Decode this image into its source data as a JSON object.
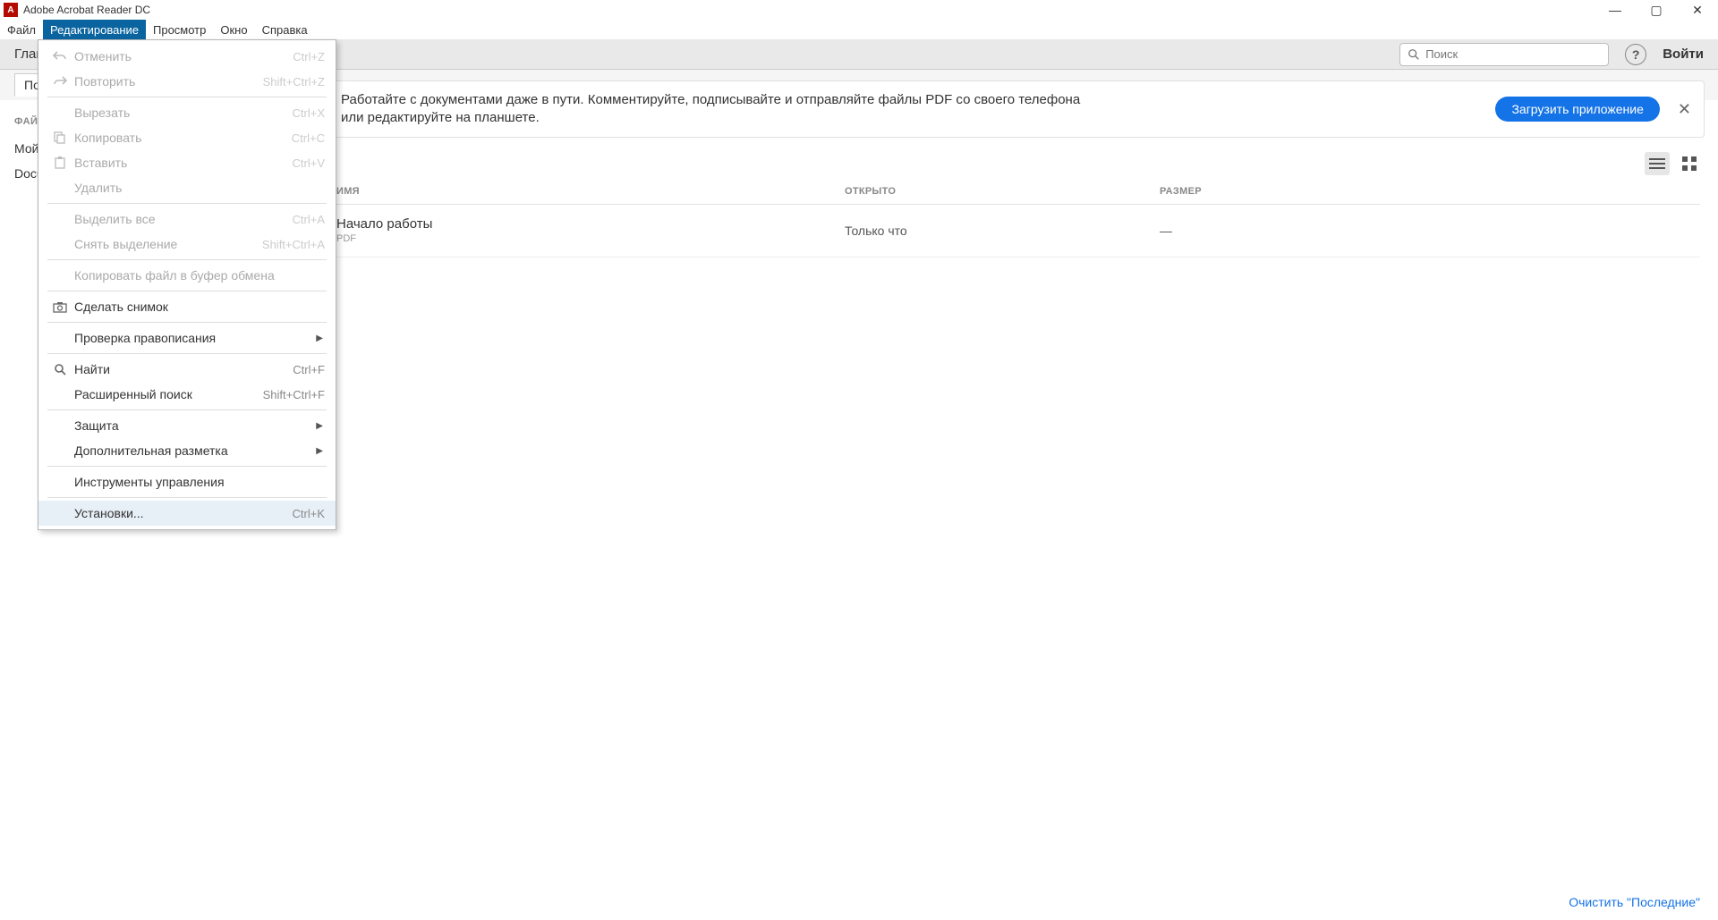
{
  "title": "Adobe Acrobat Reader DC",
  "menubar": [
    "Файл",
    "Редактирование",
    "Просмотр",
    "Окно",
    "Справка"
  ],
  "toolbar": {
    "tab": "Главная",
    "search_placeholder": "Поиск",
    "login": "Войти"
  },
  "secondbar": {
    "item": "Последние"
  },
  "sidebar": {
    "heading": "ФАЙЛЫ",
    "items": [
      "Мой компьютер",
      "Document Cloud"
    ]
  },
  "banner": {
    "line1": "Работайте с документами даже в пути. Комментируйте, подписывайте и отправляйте файлы PDF со своего телефона",
    "line2": "или редактируйте на планшете.",
    "button": "Загрузить приложение"
  },
  "table": {
    "headers": {
      "name": "ИМЯ",
      "opened": "ОТКРЫТО",
      "size": "РАЗМЕР"
    },
    "rows": [
      {
        "name": "Начало работы",
        "type": "PDF",
        "opened": "Только что",
        "size": "—"
      }
    ]
  },
  "clear_link": "Очистить \"Последние\"",
  "edit_menu": {
    "undo": {
      "label": "Отменить",
      "shortcut": "Ctrl+Z",
      "disabled": true,
      "icon": "undo"
    },
    "redo": {
      "label": "Повторить",
      "shortcut": "Shift+Ctrl+Z",
      "disabled": true,
      "icon": "redo"
    },
    "cut": {
      "label": "Вырезать",
      "shortcut": "Ctrl+X",
      "disabled": true
    },
    "copy": {
      "label": "Копировать",
      "shortcut": "Ctrl+C",
      "disabled": true,
      "icon": "copy"
    },
    "paste": {
      "label": "Вставить",
      "shortcut": "Ctrl+V",
      "disabled": true,
      "icon": "paste"
    },
    "delete": {
      "label": "Удалить",
      "disabled": true
    },
    "selectall": {
      "label": "Выделить все",
      "shortcut": "Ctrl+A",
      "disabled": true
    },
    "deselect": {
      "label": "Снять выделение",
      "shortcut": "Shift+Ctrl+A",
      "disabled": true
    },
    "copyfile": {
      "label": "Копировать файл в буфер обмена",
      "disabled": true
    },
    "snapshot": {
      "label": "Сделать снимок",
      "icon": "camera"
    },
    "spellcheck": {
      "label": "Проверка правописания",
      "submenu": true
    },
    "find": {
      "label": "Найти",
      "shortcut": "Ctrl+F",
      "icon": "search"
    },
    "advfind": {
      "label": "Расширенный поиск",
      "shortcut": "Shift+Ctrl+F"
    },
    "protect": {
      "label": "Защита",
      "submenu": true
    },
    "access": {
      "label": "Дополнительная разметка",
      "submenu": true
    },
    "tools": {
      "label": "Инструменты управления"
    },
    "prefs": {
      "label": "Установки...",
      "shortcut": "Ctrl+K",
      "hover": true
    }
  }
}
